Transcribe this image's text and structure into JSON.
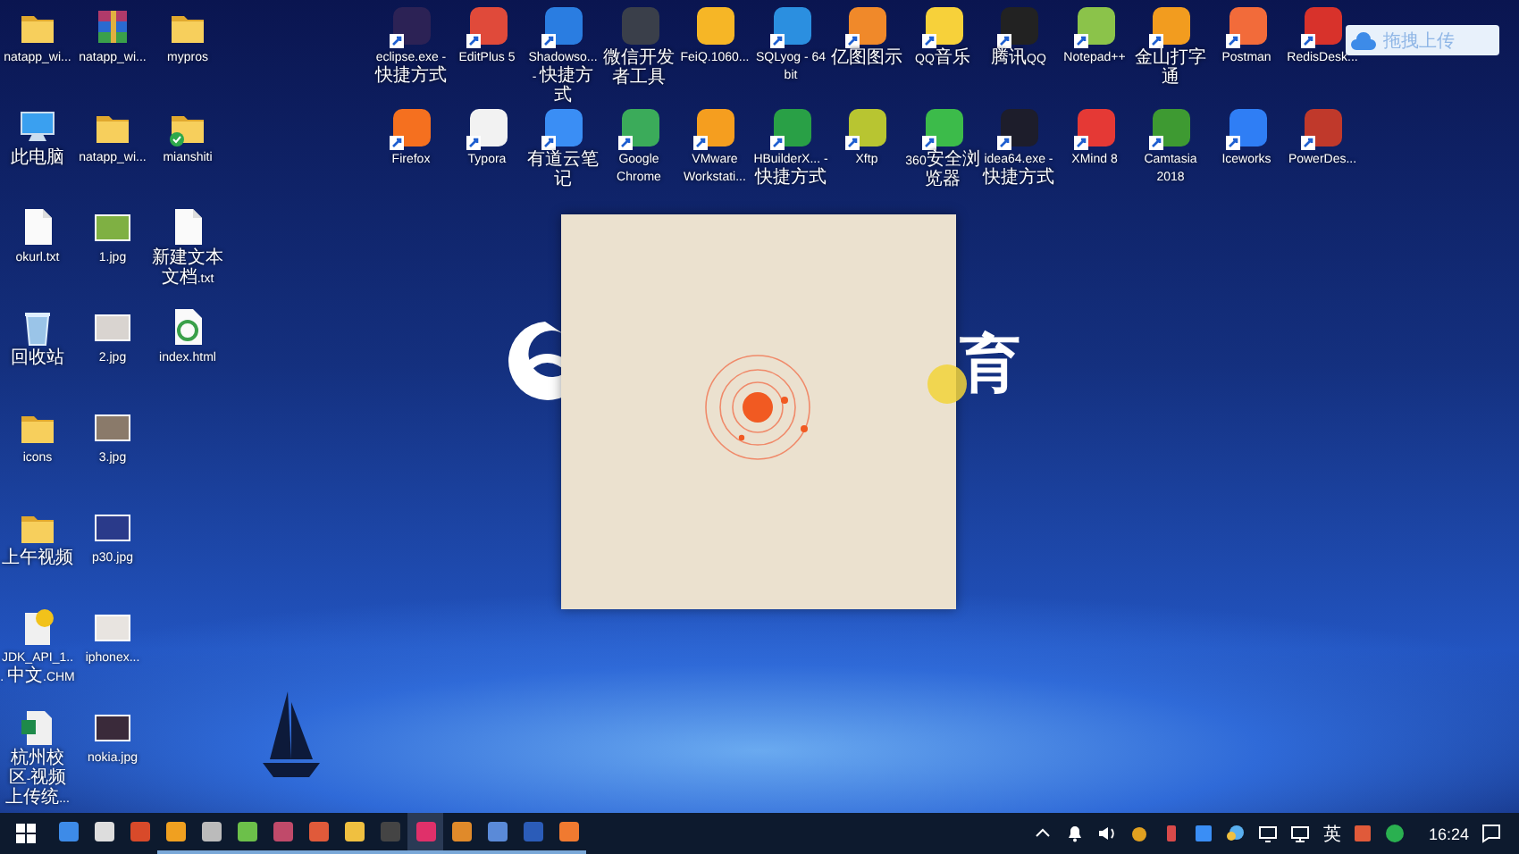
{
  "desktop_left_icons": [
    {
      "label": "natapp_wi...",
      "kind": "folder"
    },
    {
      "label": "此电脑",
      "kind": "computer"
    },
    {
      "label": "okurl.txt",
      "kind": "file"
    },
    {
      "label": "回收站",
      "kind": "recycle"
    },
    {
      "label": "icons",
      "kind": "folder"
    },
    {
      "label": "上午视频",
      "kind": "folder"
    },
    {
      "label": "JDK_API_1... 中文.CHM",
      "kind": "help"
    },
    {
      "label": "杭州校区-视频上传统...",
      "kind": "excel"
    },
    {
      "label": "natapp_wi...",
      "kind": "archive"
    },
    {
      "label": "natapp_wi...",
      "kind": "folder"
    },
    {
      "label": "1.jpg",
      "kind": "image",
      "color": "#7fb043"
    },
    {
      "label": "2.jpg",
      "kind": "image",
      "color": "#d9d4d0"
    },
    {
      "label": "3.jpg",
      "kind": "image",
      "color": "#8a7a6a"
    },
    {
      "label": "p30.jpg",
      "kind": "image",
      "color": "#2a3a8a"
    },
    {
      "label": "iphonex...",
      "kind": "image",
      "color": "#e8e4e0"
    },
    {
      "label": "nokia.jpg",
      "kind": "image",
      "color": "#3a2a3a"
    },
    {
      "label": "mypros",
      "kind": "folder"
    },
    {
      "label": "mianshiti",
      "kind": "synced-folder"
    },
    {
      "label": "新建文本文档.txt",
      "kind": "file"
    },
    {
      "label": "index.html",
      "kind": "html"
    }
  ],
  "desktop_top_icons": [
    {
      "label": "eclipse.exe - 快捷方式",
      "color": "#2c2255",
      "shortcut": true
    },
    {
      "label": "EditPlus 5",
      "color": "#e04a3a",
      "shortcut": true
    },
    {
      "label": "Shadowso... - 快捷方式",
      "color": "#2a7de1",
      "shortcut": true
    },
    {
      "label": "微信开发者工具",
      "color": "#3a3f4a",
      "shortcut": false
    },
    {
      "label": "FeiQ.1060...",
      "color": "#f6b626",
      "shortcut": false
    },
    {
      "label": "SQLyog - 64 bit",
      "color": "#2b8fe0",
      "shortcut": true
    },
    {
      "label": "亿图图示",
      "color": "#f0892a",
      "shortcut": true
    },
    {
      "label": "QQ音乐",
      "color": "#f7d13a",
      "shortcut": true
    },
    {
      "label": "腾讯QQ",
      "color": "#222222",
      "shortcut": true
    },
    {
      "label": "Notepad++",
      "color": "#8bc34a",
      "shortcut": true
    },
    {
      "label": "金山打字通",
      "color": "#f29c1f",
      "shortcut": true
    },
    {
      "label": "Postman",
      "color": "#f26b3a",
      "shortcut": true
    },
    {
      "label": "RedisDesk...",
      "color": "#d8322b",
      "shortcut": true
    },
    {
      "label": "Firefox",
      "color": "#f5701f",
      "shortcut": true
    },
    {
      "label": "Typora",
      "color": "#f2f2f2",
      "shortcut": true
    },
    {
      "label": "有道云笔记",
      "color": "#3a8ef5",
      "shortcut": true
    },
    {
      "label": "Google Chrome",
      "color": "#3bab5a",
      "shortcut": true
    },
    {
      "label": "VMware Workstati...",
      "color": "#f59e1f",
      "shortcut": true
    },
    {
      "label": "HBuilderX... - 快捷方式",
      "color": "#29a046",
      "shortcut": true
    },
    {
      "label": "Xftp",
      "color": "#b8c531",
      "shortcut": true
    },
    {
      "label": "360安全浏览器",
      "color": "#3cbb4a",
      "shortcut": true
    },
    {
      "label": "idea64.exe - 快捷方式",
      "color": "#1d1d2b",
      "shortcut": true
    },
    {
      "label": "XMind 8",
      "color": "#e53935",
      "shortcut": true
    },
    {
      "label": "Camtasia 2018",
      "color": "#3e9a32",
      "shortcut": true
    },
    {
      "label": "Iceworks",
      "color": "#2f7ef5",
      "shortcut": true
    },
    {
      "label": "PowerDes...",
      "color": "#c0392b",
      "shortcut": true
    }
  ],
  "wallpaper_logo": {
    "text": "育"
  },
  "upload_float_button": {
    "label": "拖拽上传"
  },
  "taskbar": {
    "apps": [
      {
        "color": "#3d8be8",
        "running": false,
        "selected": false
      },
      {
        "color": "#dddddd",
        "running": false,
        "selected": false
      },
      {
        "color": "#d84a2a",
        "running": false,
        "selected": false
      },
      {
        "color": "#f0a020",
        "running": true,
        "selected": false
      },
      {
        "color": "#bbbbbb",
        "running": true,
        "selected": false
      },
      {
        "color": "#6cc04a",
        "running": true,
        "selected": false
      },
      {
        "color": "#c04a6a",
        "running": true,
        "selected": false
      },
      {
        "color": "#e05a3a",
        "running": true,
        "selected": false
      },
      {
        "color": "#f0c040",
        "running": true,
        "selected": false
      },
      {
        "color": "#444444",
        "running": true,
        "selected": false
      },
      {
        "color": "#e0306a",
        "running": true,
        "selected": true
      },
      {
        "color": "#e08a2a",
        "running": true,
        "selected": false
      },
      {
        "color": "#5a8ad8",
        "running": true,
        "selected": false
      },
      {
        "color": "#2b5cb8",
        "running": true,
        "selected": false
      },
      {
        "color": "#f07a30",
        "running": true,
        "selected": false
      }
    ],
    "ime": "英",
    "clock": "16:24"
  }
}
